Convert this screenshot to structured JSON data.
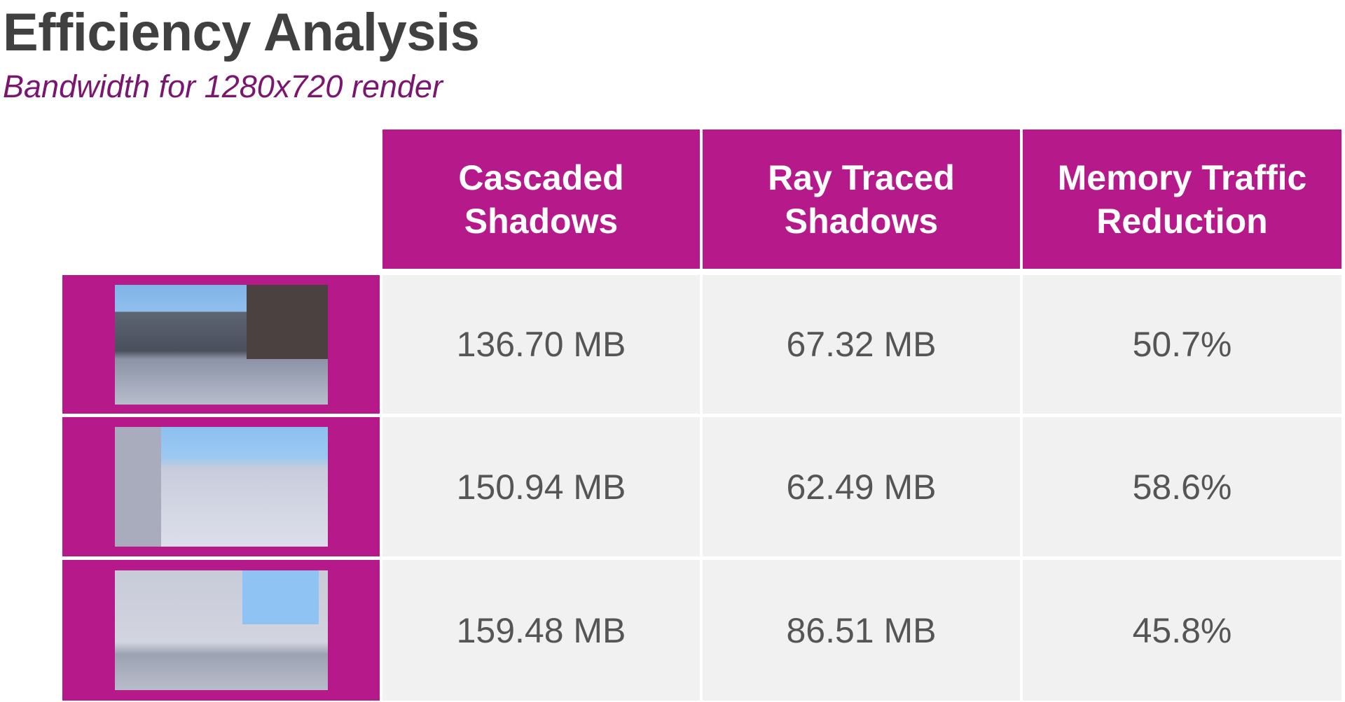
{
  "title": "Efficiency Analysis",
  "subtitle": "Bandwidth for 1280x720 render",
  "colors": {
    "accent": "#b5198a",
    "cell_bg": "#f1f1f1",
    "subtitle": "#7b1670"
  },
  "table": {
    "headers": [
      "Cascaded Shadows",
      "Ray Traced Shadows",
      "Memory Traffic Reduction"
    ],
    "rows": [
      {
        "image": "street-scene-thumbnail-1",
        "cascaded": "136.70 MB",
        "ray_traced": "67.32 MB",
        "reduction": "50.7%"
      },
      {
        "image": "alley-scene-thumbnail-2",
        "cascaded": "150.94 MB",
        "ray_traced": "62.49 MB",
        "reduction": "58.6%"
      },
      {
        "image": "industrial-scene-thumbnail-3",
        "cascaded": "159.48 MB",
        "ray_traced": "86.51 MB",
        "reduction": "45.8%"
      }
    ]
  }
}
